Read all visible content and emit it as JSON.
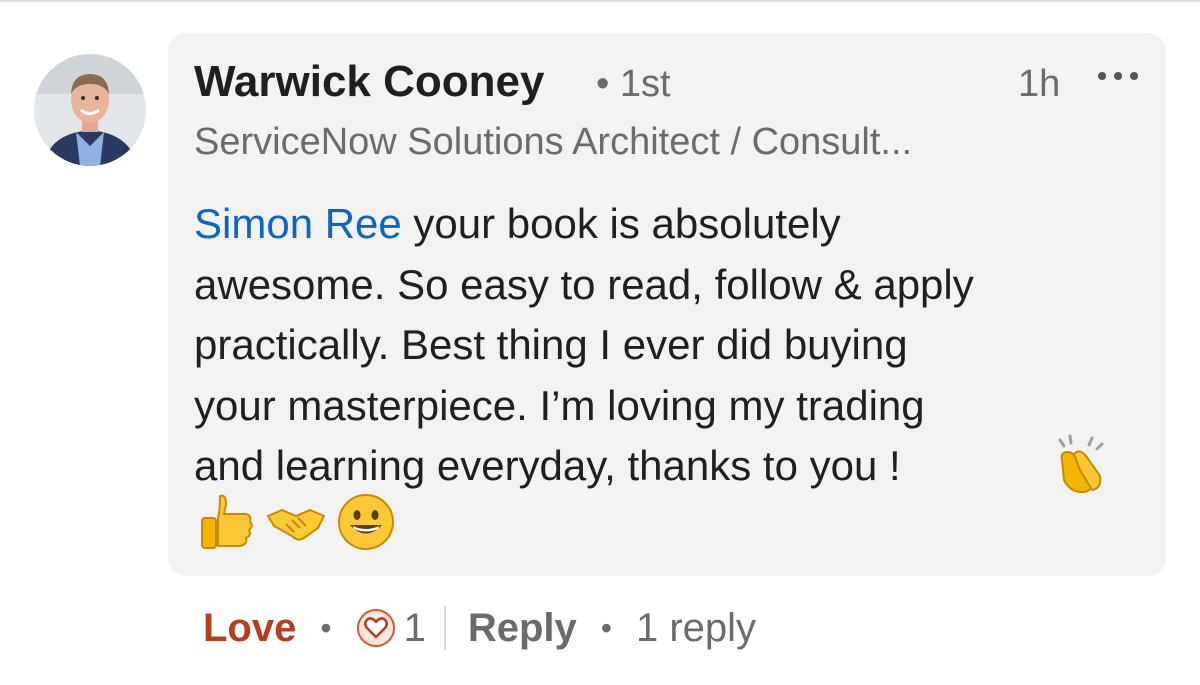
{
  "comment": {
    "author": {
      "name": "Warwick Cooney",
      "degree": "• 1st",
      "headline": "ServiceNow Solutions Architect / Consult..."
    },
    "timestamp": "1h",
    "more_icon": "ellipsis-horizontal-icon",
    "mention": "Simon Ree",
    "body_lines": [
      " your book is absolutely",
      "awesome. So easy to read, follow & apply",
      "practically. Best thing I ever did buying",
      "your masterpiece. I’m loving my trading",
      "and learning everyday, thanks to you !"
    ],
    "emojis": [
      "clapping-hands-icon",
      "thumbs-up-icon",
      "handshake-icon",
      "grinning-face-icon"
    ]
  },
  "actions": {
    "love_label": "Love",
    "separator": "•",
    "reaction_icon": "heart-reaction-icon",
    "reaction_count": "1",
    "reply_label": "Reply",
    "replies_label": "1 reply"
  },
  "colors": {
    "mention": "#0a66c2",
    "love": "#b24020",
    "bubble": "#f2f2f2",
    "muted_text": "#6b6b6b"
  }
}
